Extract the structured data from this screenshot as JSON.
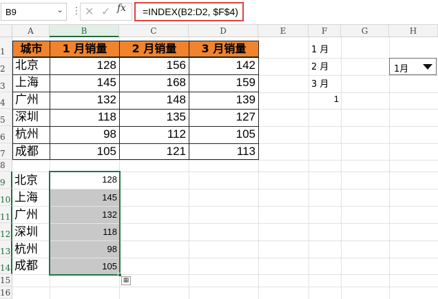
{
  "formula_bar": {
    "name_box": "B9",
    "cancel_glyph": "✕",
    "confirm_glyph": "✓",
    "fx_label": "fx",
    "formula": "=INDEX(B2:D2, $F$4)"
  },
  "columns": [
    "A",
    "B",
    "C",
    "D",
    "E",
    "F",
    "G",
    "H"
  ],
  "rows": [
    "1",
    "2",
    "3",
    "4",
    "5",
    "6",
    "7",
    "8",
    "9",
    "10",
    "11",
    "12",
    "13",
    "14",
    "15",
    "16"
  ],
  "table": {
    "headers": [
      "城市",
      "1 月销量",
      "2 月销量",
      "3 月销量"
    ],
    "rows": [
      {
        "city": "北京",
        "m1": "128",
        "m2": "156",
        "m3": "142"
      },
      {
        "city": "上海",
        "m1": "145",
        "m2": "168",
        "m3": "159"
      },
      {
        "city": "广州",
        "m1": "132",
        "m2": "148",
        "m3": "139"
      },
      {
        "city": "深圳",
        "m1": "118",
        "m2": "135",
        "m3": "127"
      },
      {
        "city": "杭州",
        "m1": "98",
        "m2": "112",
        "m3": "105"
      },
      {
        "city": "成都",
        "m1": "105",
        "m2": "121",
        "m3": "113"
      }
    ]
  },
  "month_list": [
    "1 月",
    "2 月",
    "3 月"
  ],
  "f4_value": "1",
  "result": {
    "cities": [
      "北京",
      "上海",
      "广州",
      "深圳",
      "杭州",
      "成都"
    ],
    "values": [
      "128",
      "145",
      "132",
      "118",
      "98",
      "105"
    ]
  },
  "dropdown": {
    "selected": "1月",
    "arrow": "caret-down-icon"
  },
  "colors": {
    "header_fill": "#f0832c",
    "selection": "#217346",
    "highlight": "#c8c8c8",
    "formula_border": "#d9433c"
  }
}
